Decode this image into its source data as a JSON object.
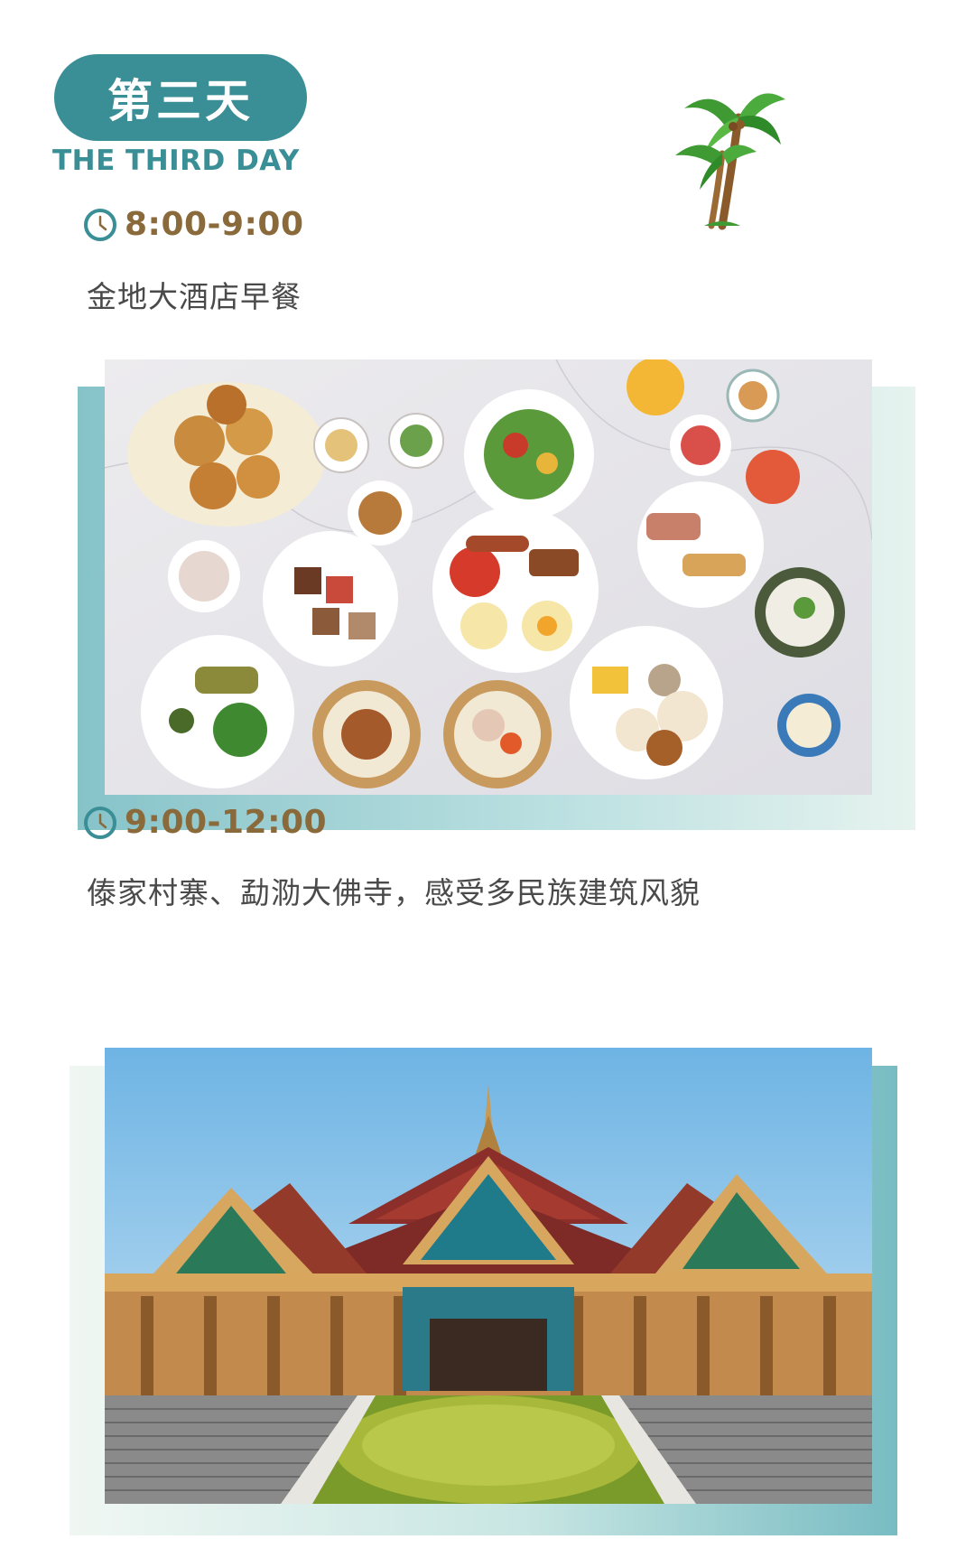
{
  "header": {
    "day_label_cn": "第三天",
    "day_label_en": "THE THIRD DAY"
  },
  "decoration": {
    "icon": "palm-tree-icon"
  },
  "schedule": [
    {
      "time": "8:00-9:00",
      "description": "金地大酒店早餐",
      "image": "breakfast-buffet-photo"
    },
    {
      "time": "9:00-12:00",
      "description": "傣家村寨、勐泐大佛寺，感受多民族建筑风貌",
      "image": "temple-photo"
    }
  ],
  "colors": {
    "accent_teal": "#3a8e95",
    "time_gold": "#8a6a3b",
    "body_text": "#4a4a4a"
  }
}
